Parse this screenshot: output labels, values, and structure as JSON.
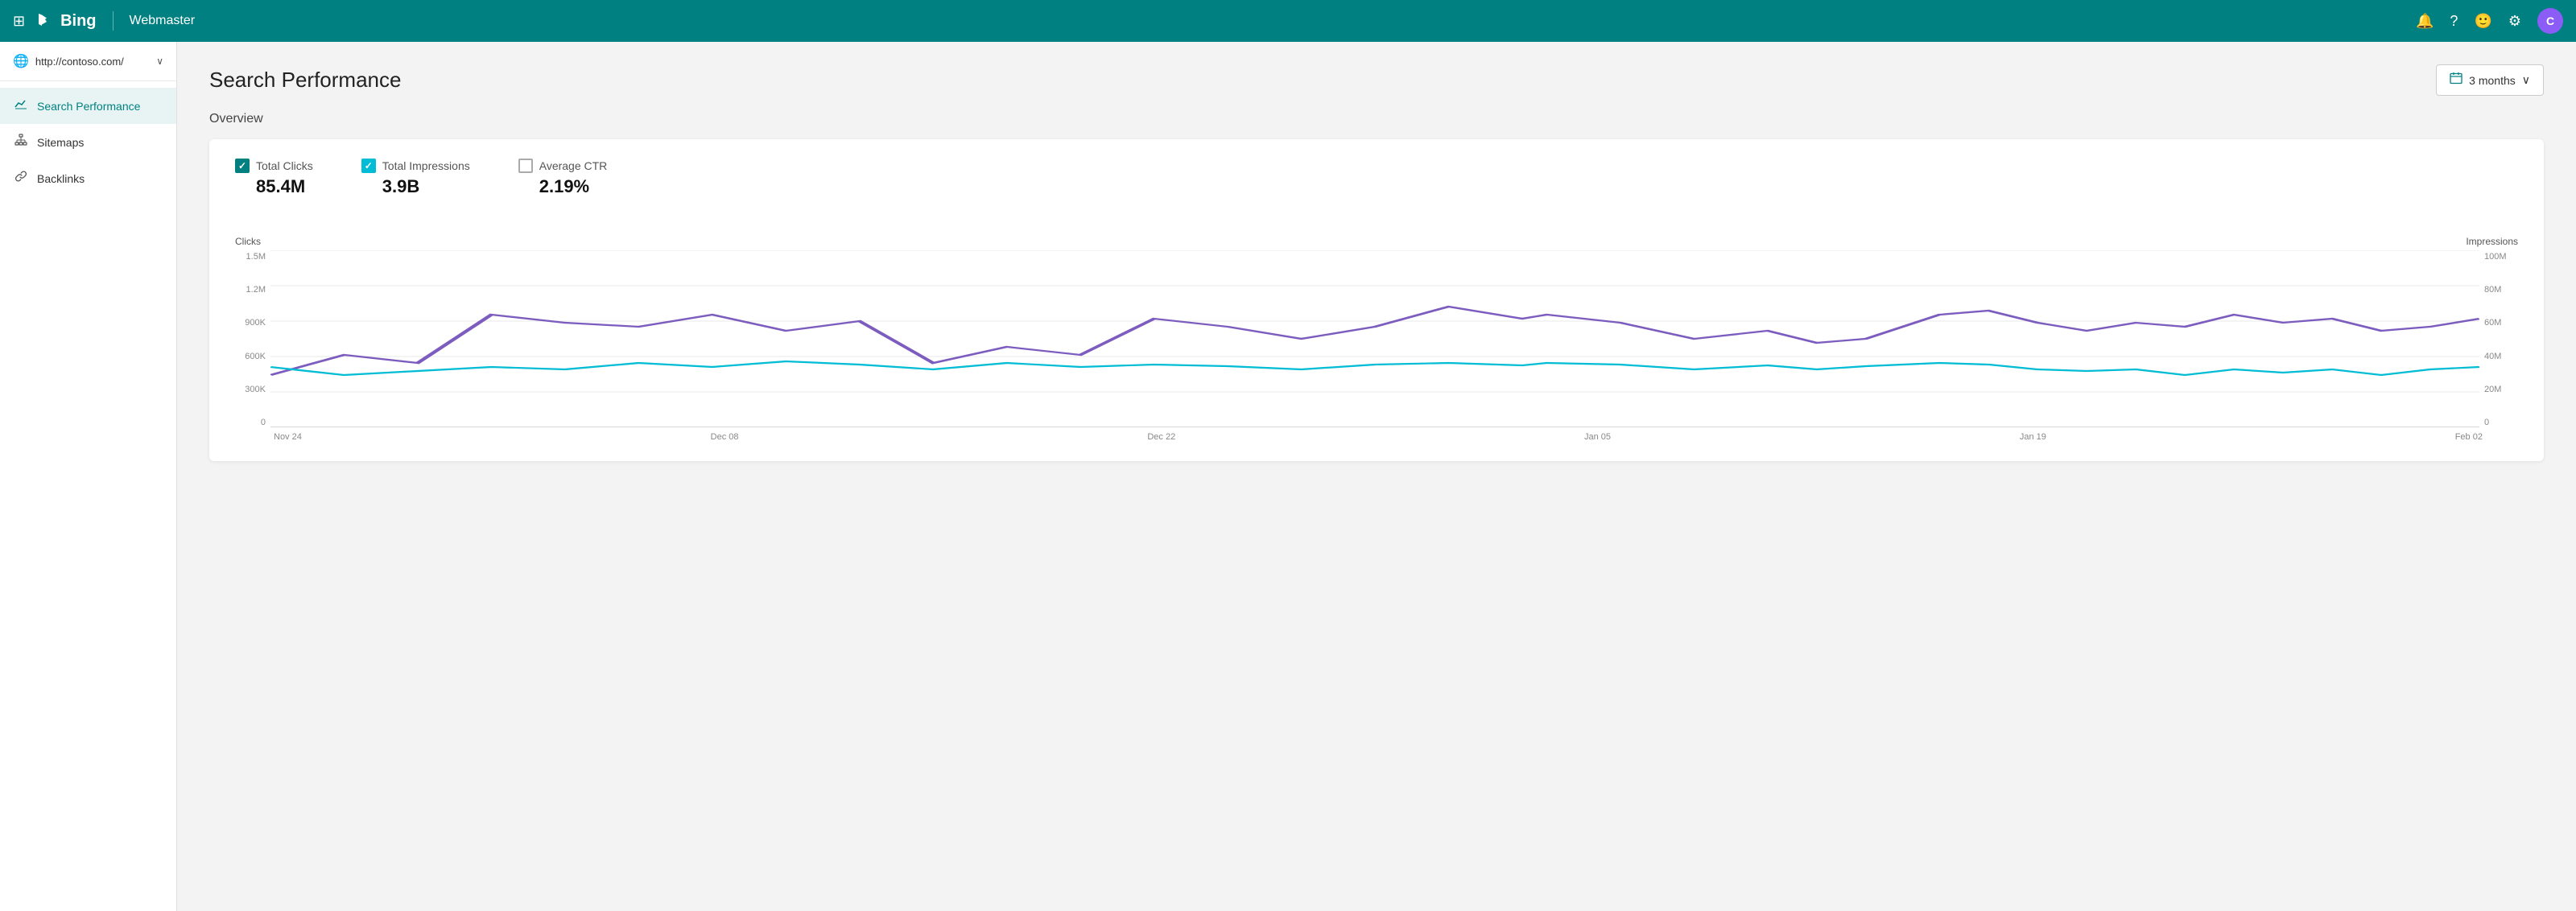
{
  "topnav": {
    "logo_text": "Bing",
    "divider": "|",
    "app_title": "Webmaster",
    "avatar_letter": "C",
    "icons": {
      "grid": "⊞",
      "bell": "🔔",
      "help": "?",
      "smiley": "🙂",
      "settings": "⚙"
    }
  },
  "sidebar": {
    "url": "http://contoso.com/",
    "chevron": "∨",
    "nav_items": [
      {
        "id": "search-performance",
        "label": "Search Performance",
        "icon": "📈",
        "active": true
      },
      {
        "id": "sitemaps",
        "label": "Sitemaps",
        "icon": "🗺",
        "active": false
      },
      {
        "id": "backlinks",
        "label": "Backlinks",
        "icon": "🔗",
        "active": false
      }
    ]
  },
  "main": {
    "title": "Search Performance",
    "date_filter": {
      "label": "3 months",
      "icon": "📅",
      "chevron": "∨"
    },
    "overview_label": "Overview",
    "metrics": [
      {
        "id": "total-clicks",
        "name": "Total Clicks",
        "value": "85.4M",
        "checked": true
      },
      {
        "id": "total-impressions",
        "name": "Total Impressions",
        "value": "3.9B",
        "checked": true
      },
      {
        "id": "average-ctr",
        "name": "Average CTR",
        "value": "2.19%",
        "checked": false
      }
    ],
    "chart": {
      "left_axis_label": "Clicks",
      "right_axis_label": "Impressions",
      "y_left_labels": [
        "1.5M",
        "1.2M",
        "900K",
        "600K",
        "300K",
        "0"
      ],
      "y_right_labels": [
        "100M",
        "80M",
        "60M",
        "40M",
        "20M",
        "0"
      ],
      "x_labels": [
        "Nov 24",
        "Dec 08",
        "Dec 22",
        "Jan 05",
        "Jan 19",
        "Feb 02"
      ]
    }
  }
}
